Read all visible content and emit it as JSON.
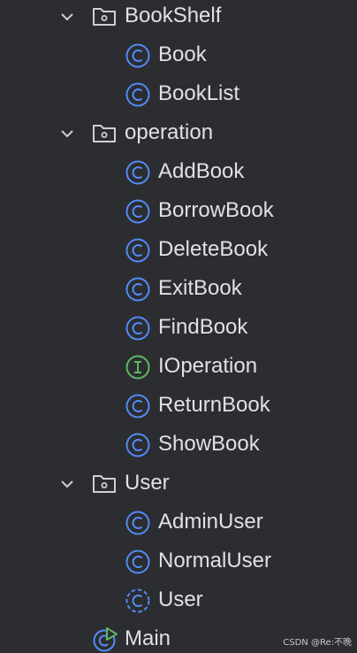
{
  "tree": {
    "bookshelf": {
      "label": "BookShelf",
      "icon": "package-folder-icon",
      "children": [
        {
          "label": "Book",
          "icon": "class-icon"
        },
        {
          "label": "BookList",
          "icon": "class-icon"
        }
      ]
    },
    "operation": {
      "label": "operation",
      "icon": "package-folder-icon",
      "children": [
        {
          "label": "AddBook",
          "icon": "class-icon"
        },
        {
          "label": "BorrowBook",
          "icon": "class-icon"
        },
        {
          "label": "DeleteBook",
          "icon": "class-icon"
        },
        {
          "label": "ExitBook",
          "icon": "class-icon"
        },
        {
          "label": "FindBook",
          "icon": "class-icon"
        },
        {
          "label": "IOperation",
          "icon": "interface-icon"
        },
        {
          "label": "ReturnBook",
          "icon": "class-icon"
        },
        {
          "label": "ShowBook",
          "icon": "class-icon"
        }
      ]
    },
    "user": {
      "label": "User",
      "icon": "package-folder-icon",
      "children": [
        {
          "label": "AdminUser",
          "icon": "class-icon"
        },
        {
          "label": "NormalUser",
          "icon": "class-icon"
        },
        {
          "label": "User",
          "icon": "abstract-class-icon"
        }
      ]
    },
    "main": {
      "label": "Main",
      "icon": "runnable-class-icon"
    }
  },
  "colors": {
    "background": "#2b2d30",
    "text": "#dfe1e5",
    "class_icon": "#548af7",
    "interface_icon": "#5fb865",
    "folder_icon": "#ced0d6"
  },
  "watermark": "CSDN @Re:不晚"
}
